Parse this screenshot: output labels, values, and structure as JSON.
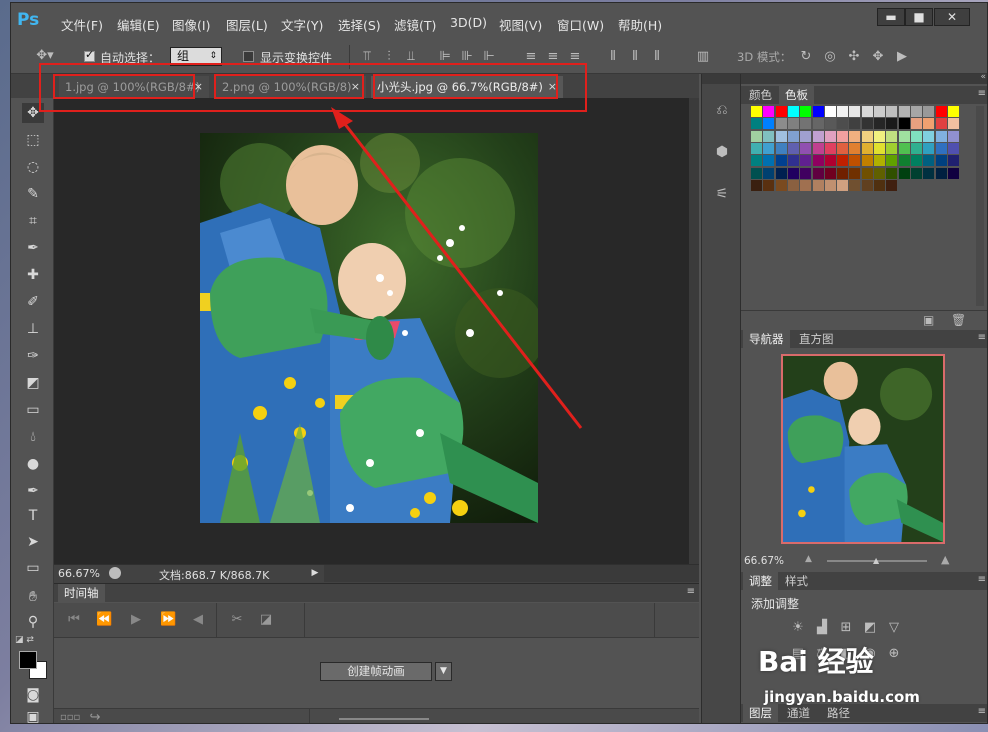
{
  "app": {
    "logo": "Ps"
  },
  "menu": [
    "文件(F)",
    "编辑(E)",
    "图像(I)",
    "图层(L)",
    "文字(Y)",
    "选择(S)",
    "滤镜(T)",
    "3D(D)",
    "视图(V)",
    "窗口(W)",
    "帮助(H)"
  ],
  "window_controls": {
    "minimize": "▬",
    "maximize": "■",
    "close": "✕"
  },
  "options": {
    "auto_select_label": "自动选择：",
    "auto_select_checked": true,
    "auto_select_value": "组",
    "show_transform_label": "显示变换控件",
    "mode_3d_label": "3D 模式："
  },
  "tabs": [
    {
      "label": "1.jpg @ 100%(RGB/8#)",
      "close": "×",
      "active": false
    },
    {
      "label": "2.png @ 100%(RGB/8)",
      "close": "×",
      "active": false
    },
    {
      "label": "小光头.jpg @ 66.7%(RGB/8#)",
      "close": "×",
      "active": true
    }
  ],
  "status": {
    "zoom": "66.67%",
    "doc_info": "文档:868.7 K/868.7K"
  },
  "timeline": {
    "tab": "时间轴",
    "create_button": "创建帧动画"
  },
  "swatches_panel": {
    "tabs": [
      "颜色",
      "色板"
    ],
    "active": "色板"
  },
  "swatch_rows": [
    [
      "#ffff00",
      "#ff00ff",
      "#ff0000",
      "#00ffff",
      "#00ff00",
      "#0000ff",
      "#ffffff",
      "#f2f2f2",
      "#e6e6e6",
      "#d9d9d9",
      "#cccccc",
      "#bfbfbf",
      "#b3b3b3",
      "#a6a6a6",
      "#999999",
      "#ff0000",
      "#ffff00"
    ],
    [
      "#008080",
      "#0080ff",
      "#8c8c8c",
      "#808080",
      "#737373",
      "#666666",
      "#595959",
      "#4d4d4d",
      "#404040",
      "#333333",
      "#262626",
      "#1a1a1a",
      "#000000",
      "#e6a080",
      "#f0a070",
      "#e04040",
      "#f0c0a0"
    ],
    [
      "#a0d0a0",
      "#80c0c0",
      "#a0c0e0",
      "#80a0d0",
      "#a0a0d0",
      "#c0a0d0",
      "#e0a0c0",
      "#f0a0a0",
      "#f0b080",
      "#f0d080",
      "#f0f080",
      "#c0e080",
      "#a0e0a0",
      "#80e0c0",
      "#80d0e0",
      "#80b0e0",
      "#9090d0"
    ],
    [
      "#40b0b0",
      "#40a0d0",
      "#4080c0",
      "#6060b0",
      "#9050b0",
      "#c04090",
      "#e04060",
      "#e06040",
      "#e08030",
      "#e0b030",
      "#e0e030",
      "#a0d030",
      "#50c050",
      "#30b090",
      "#30a0c0",
      "#3070c0",
      "#5050b0"
    ],
    [
      "#008080",
      "#0070b0",
      "#004090",
      "#303090",
      "#602090",
      "#900060",
      "#b00030",
      "#c02000",
      "#c05000",
      "#c08000",
      "#b0b000",
      "#60a000",
      "#108030",
      "#008060",
      "#006080",
      "#004080",
      "#202070"
    ],
    [
      "#005050",
      "#004070",
      "#002050",
      "#200060",
      "#400060",
      "#600040",
      "#700020",
      "#702000",
      "#703000",
      "#705000",
      "#606000",
      "#305000",
      "#004010",
      "#004030",
      "#003040",
      "#002040",
      "#100040"
    ],
    [
      "#3a2010",
      "#5a3010",
      "#7a4a20",
      "#8a6040",
      "#a07050",
      "#b08060",
      "#c09070",
      "#d0a080",
      "#705030",
      "#604020",
      "#503010",
      "#402010"
    ]
  ],
  "navigator": {
    "tabs": [
      "导航器",
      "直方图"
    ],
    "zoom": "66.67%"
  },
  "adjust": {
    "tabs": [
      "调整",
      "样式"
    ],
    "add_label": "添加调整"
  },
  "bottom_tabs": [
    "图层",
    "通道",
    "路径"
  ],
  "watermark": {
    "text": "Bai 经验",
    "url": "jingyan.baidu.com"
  }
}
